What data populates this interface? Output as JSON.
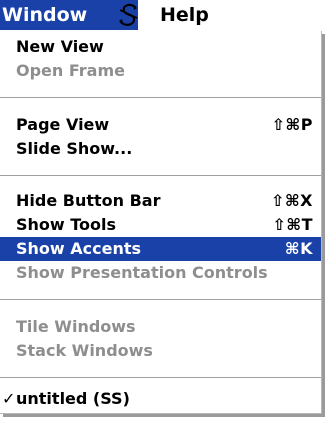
{
  "menubar": {
    "window_label": "Window",
    "app_icon": "script-s-icon",
    "help_label": "Help"
  },
  "menu": {
    "items": [
      {
        "label": "New View",
        "shortcut": "",
        "enabled": true
      },
      {
        "label": "Open Frame",
        "shortcut": "",
        "enabled": false
      },
      {
        "label": "Page View",
        "shortcut": "⇧⌘P",
        "enabled": true
      },
      {
        "label": "Slide Show...",
        "shortcut": "",
        "enabled": true
      },
      {
        "label": "Hide Button Bar",
        "shortcut": "⇧⌘X",
        "enabled": true
      },
      {
        "label": "Show Tools",
        "shortcut": "⇧⌘T",
        "enabled": true
      },
      {
        "label": "Show Accents",
        "shortcut": "⌘K",
        "enabled": true,
        "highlighted": true
      },
      {
        "label": "Show Presentation Controls",
        "shortcut": "",
        "enabled": false
      },
      {
        "label": "Tile Windows",
        "shortcut": "",
        "enabled": false
      },
      {
        "label": "Stack Windows",
        "shortcut": "",
        "enabled": false
      },
      {
        "label": "untitled (SS)",
        "shortcut": "",
        "enabled": true,
        "checked": true,
        "check_mark": "✓"
      }
    ]
  },
  "colors": {
    "highlight": "#1a41a8",
    "disabled_text": "#8e8e8e"
  }
}
